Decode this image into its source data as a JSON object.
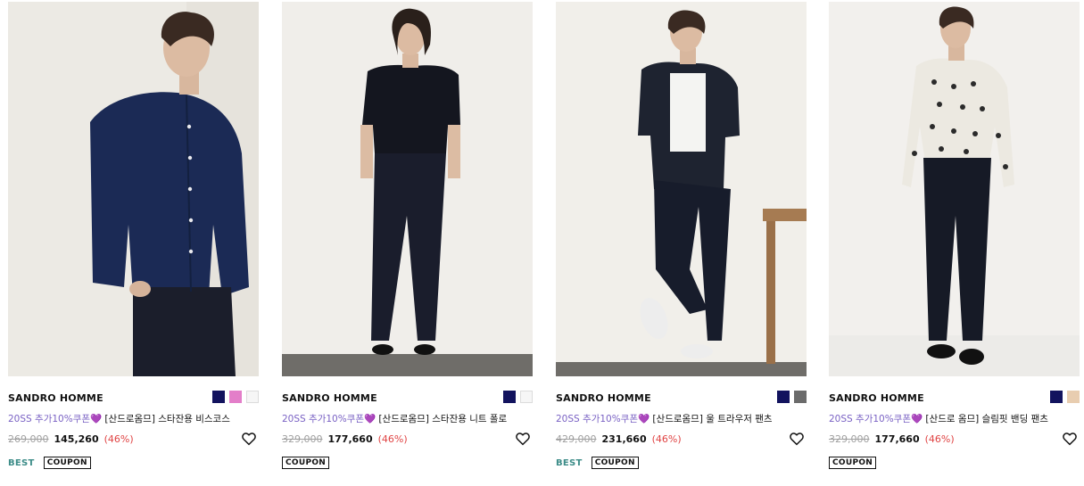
{
  "products": [
    {
      "brand": "SANDRO HOMME",
      "promo": "20SS 추가10%쿠폰💜",
      "name": " [산드로옴므] 스타잔용 비스코스",
      "original_price": "269,000",
      "sale_price": "145,260",
      "discount": "(46%)",
      "swatches": [
        "#12135e",
        "#e37ec9",
        "#f6f6f6"
      ],
      "tags": [
        "BEST",
        "COUPON"
      ]
    },
    {
      "brand": "SANDRO HOMME",
      "promo": "20SS 추가10%쿠폰💜",
      "name": " [산드로옴므] 스타잔용 니트 폴로",
      "original_price": "329,000",
      "sale_price": "177,660",
      "discount": "(46%)",
      "swatches": [
        "#12135e",
        "#f6f6f6"
      ],
      "tags": [
        "COUPON"
      ]
    },
    {
      "brand": "SANDRO HOMME",
      "promo": "20SS 추가10%쿠폰💜",
      "name": " [산드로옴므] 울 트라우저 팬츠",
      "original_price": "429,000",
      "sale_price": "231,660",
      "discount": "(46%)",
      "swatches": [
        "#12135e",
        "#6b6b6b"
      ],
      "tags": [
        "BEST",
        "COUPON"
      ]
    },
    {
      "brand": "SANDRO HOMME",
      "promo": "20SS 추가10%쿠폰💜",
      "name": " [산드로 옴므] 슬림핏 밴딩 팬츠",
      "original_price": "329,000",
      "sale_price": "177,660",
      "discount": "(46%)",
      "swatches": [
        "#12135e",
        "#e8cdb0"
      ],
      "tags": [
        "COUPON"
      ]
    }
  ]
}
